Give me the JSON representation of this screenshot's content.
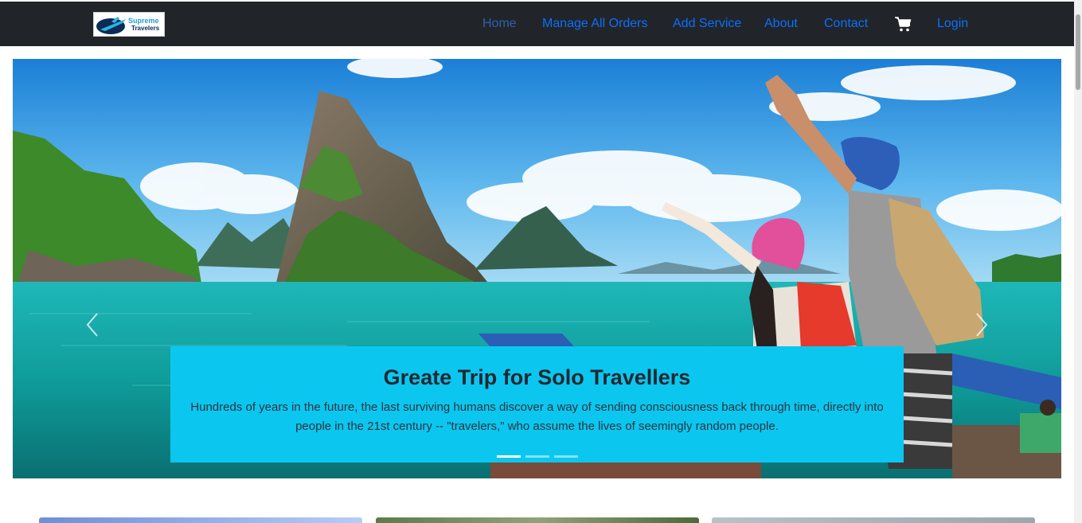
{
  "brand": {
    "logo_line1": "Supreme",
    "logo_line2": "Travelers"
  },
  "nav": {
    "items": [
      {
        "label": "Home",
        "active": true
      },
      {
        "label": "Manage All Orders"
      },
      {
        "label": "Add Service"
      },
      {
        "label": "About"
      },
      {
        "label": "Contact"
      }
    ],
    "cart_icon": "cart-icon",
    "login_label": "Login"
  },
  "carousel": {
    "caption_title": "Greate Trip for Solo Travellers",
    "caption_text": "Hundreds of years in the future, the last surviving humans discover a way of sending consciousness back through time, directly into people in the 21st century -- \"travelers,\" who assume the lives of seemingly random people.",
    "slides_count": 3,
    "active_slide": 1,
    "prev_icon": "chevron-left-icon",
    "next_icon": "chevron-right-icon"
  },
  "colors": {
    "navbar": "#212529",
    "link": "#0d6efd",
    "caption_bg": "#0bc7ef"
  }
}
